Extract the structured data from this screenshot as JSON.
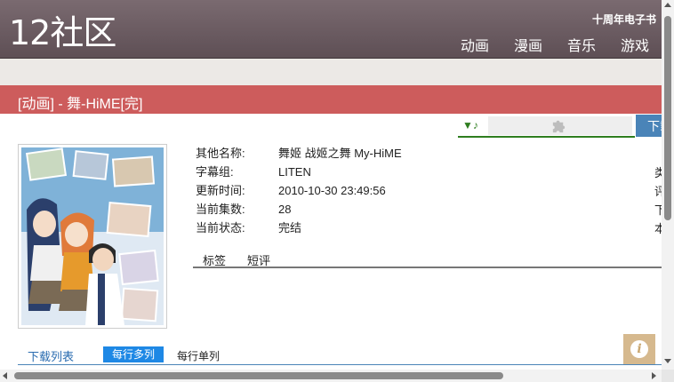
{
  "header": {
    "logo": "12社区",
    "promo": "十周年电子书",
    "nav": [
      "动画",
      "漫画",
      "音乐",
      "游戏"
    ]
  },
  "title_bar": {
    "title": "[动画] - 舞-HiME[完]"
  },
  "download_bar": {
    "music_icon": "▼♪",
    "puzzle_icon": "puzzle-piece-icon",
    "tab_label": "下载"
  },
  "details": {
    "rows": [
      {
        "label": "其他名称:",
        "value": "舞姬 战姬之舞 My-HiME"
      },
      {
        "label": "字幕组:",
        "value": "LITEN"
      },
      {
        "label": "更新时间:",
        "value": "2010-10-30 23:49:56"
      },
      {
        "label": "当前集数:",
        "value": "28"
      },
      {
        "label": "当前状态:",
        "value": "完结"
      }
    ],
    "right_column_partial": [
      "类",
      "评",
      "下",
      "本"
    ]
  },
  "tabs": [
    "标签",
    "短评"
  ],
  "download_list": {
    "title": "下载列表",
    "mode_multi": "每行多列",
    "mode_single": "每行单列"
  },
  "colors": {
    "header": "#6b5a60",
    "title_bar": "#cd5c5c",
    "download_tab": "#4a84b8",
    "accent_green": "#2e7d1f",
    "active_mode": "#1e88e5",
    "info_button": "#d6b98e"
  }
}
